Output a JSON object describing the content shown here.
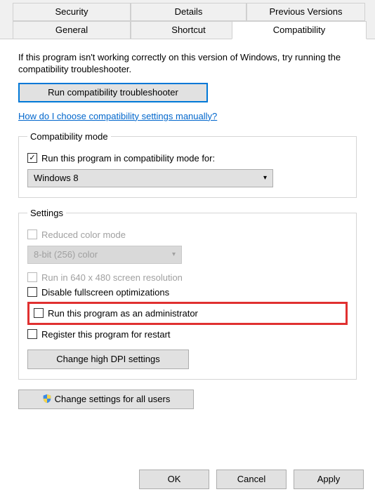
{
  "tabs": {
    "security": "Security",
    "details": "Details",
    "previous_versions": "Previous Versions",
    "general": "General",
    "shortcut": "Shortcut",
    "compatibility": "Compatibility"
  },
  "intro": "If this program isn't working correctly on this version of Windows, try running the compatibility troubleshooter.",
  "run_troubleshooter_label": "Run compatibility troubleshooter",
  "help_link": "How do I choose compatibility settings manually?",
  "compat_mode": {
    "legend": "Compatibility mode",
    "checkbox_label": "Run this program in compatibility mode for:",
    "checked": true,
    "selected_os": "Windows 8"
  },
  "settings": {
    "legend": "Settings",
    "reduced_color_label": "Reduced color mode",
    "reduced_color_checked": false,
    "color_depth_selected": "8-bit (256) color",
    "run_640_label": "Run in 640 x 480 screen resolution",
    "run_640_checked": false,
    "disable_fullscreen_label": "Disable fullscreen optimizations",
    "disable_fullscreen_checked": false,
    "run_as_admin_label": "Run this program as an administrator",
    "run_as_admin_checked": false,
    "register_restart_label": "Register this program for restart",
    "register_restart_checked": false,
    "high_dpi_label": "Change high DPI settings"
  },
  "all_users_label": "Change settings for all users",
  "buttons": {
    "ok": "OK",
    "cancel": "Cancel",
    "apply": "Apply"
  }
}
